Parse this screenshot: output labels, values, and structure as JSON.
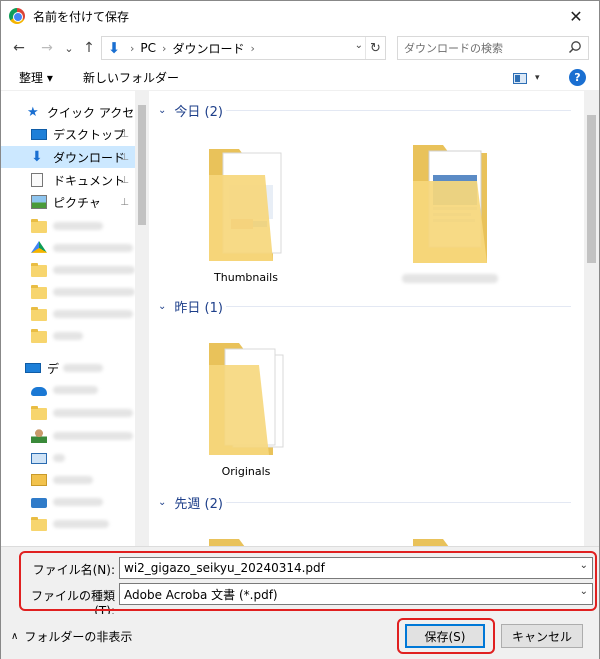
{
  "window": {
    "title": "名前を付けて保存",
    "close_glyph": "✕"
  },
  "nav_buttons": {
    "back": "←",
    "forward": "→",
    "recent": "⌄",
    "up": "↑"
  },
  "address": {
    "crumbs": [
      "PC",
      "ダウンロード"
    ],
    "separator": "›",
    "refresh": "↻",
    "dropdown": "⌄"
  },
  "search": {
    "placeholder": "ダウンロードの検索"
  },
  "toolbar": {
    "organize_label": "整理 ▾",
    "new_folder_label": "新しいフォルダー",
    "help_label": "?",
    "view_caret": "▾"
  },
  "nav_pane": {
    "quick_access": "クイック アクセス",
    "items": [
      {
        "label": "デスクトップ",
        "icon": "desktop-icon",
        "pinned": true
      },
      {
        "label": "ダウンロード",
        "icon": "download-icon",
        "pinned": true,
        "selected": true
      },
      {
        "label": "ドキュメント",
        "icon": "document-icon",
        "pinned": true
      },
      {
        "label": "ピクチャ",
        "icon": "picture-icon",
        "pinned": true
      }
    ],
    "pin_glyph": "📌",
    "this_pc_prefix": "デ"
  },
  "groups": [
    {
      "title": "今日 (2)",
      "caret": "⌄"
    },
    {
      "title": "昨日 (1)",
      "caret": "⌄"
    },
    {
      "title": "先週 (2)",
      "caret": "⌄"
    }
  ],
  "files": {
    "today_1": "Thumbnails",
    "yesterday_1": "Originals"
  },
  "form": {
    "filename_label": "ファイル名(N):",
    "filename_value": "wi2_gigazo_seikyu_20240314.pdf",
    "filetype_label": "ファイルの種類(T):",
    "filetype_value": "Adobe Acroba 文書 (*.pdf)",
    "dropdown": "⌄"
  },
  "footer": {
    "hide_folders": "フォルダーの非表示",
    "caret": "∧",
    "save_label": "保存(S)",
    "cancel_label": "キャンセル"
  },
  "colors": {
    "accent": "#0078d7",
    "selection": "#cce8ff",
    "highlight": "#e02020",
    "group_header": "#1e3f8a"
  }
}
